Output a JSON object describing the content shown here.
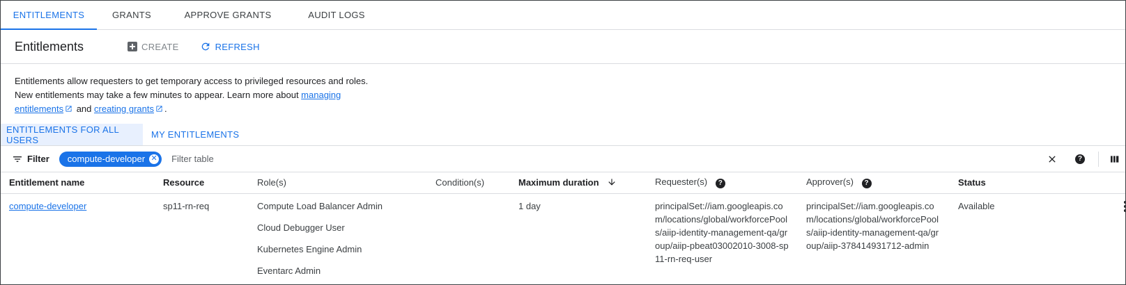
{
  "top_tabs": [
    {
      "label": "ENTITLEMENTS",
      "active": true
    },
    {
      "label": "GRANTS",
      "active": false
    },
    {
      "label": "APPROVE GRANTS",
      "active": false
    },
    {
      "label": "AUDIT LOGS",
      "active": false
    }
  ],
  "header": {
    "title": "Entitlements",
    "create_label": "CREATE",
    "refresh_label": "REFRESH"
  },
  "description": {
    "line1": "Entitlements allow requesters to get temporary access to privileged resources and roles.",
    "line2_prefix": "New entitlements may take a few minutes to appear. Learn more about ",
    "link_managing_1": "managing",
    "link_managing_2": "entitlements",
    "and_text": " and ",
    "link_grants": "creating grants",
    "period": "."
  },
  "sub_tabs": [
    {
      "label": "ENTITLEMENTS FOR ALL USERS",
      "active": true
    },
    {
      "label": "MY ENTITLEMENTS",
      "active": false
    }
  ],
  "filter": {
    "label": "Filter",
    "chip": "compute-developer",
    "placeholder": "Filter table"
  },
  "columns": {
    "name": "Entitlement name",
    "resource": "Resource",
    "roles": "Role(s)",
    "conditions": "Condition(s)",
    "max_duration": "Maximum duration",
    "requesters": "Requester(s)",
    "approvers": "Approver(s)",
    "status": "Status"
  },
  "rows": [
    {
      "name": "compute-developer",
      "resource": "sp11-rn-req",
      "roles": [
        "Compute Load Balancer Admin",
        "Cloud Debugger User",
        "Kubernetes Engine Admin",
        "Eventarc Admin"
      ],
      "conditions": "",
      "max_duration": "1 day",
      "requester": "principalSet://iam.googleapis.com/locations/global/workforcePools/aiip-identity-management-qa/group/aiip-pbeat03002010-3008-sp11-rn-req-user",
      "approver": "principalSet://iam.googleapis.com/locations/global/workforcePools/aiip-identity-management-qa/group/aiip-378414931712-admin",
      "status": "Available"
    }
  ],
  "colors": {
    "accent": "#1a73e8",
    "accent_light": "#e8f0fe",
    "border": "#dadce0"
  }
}
